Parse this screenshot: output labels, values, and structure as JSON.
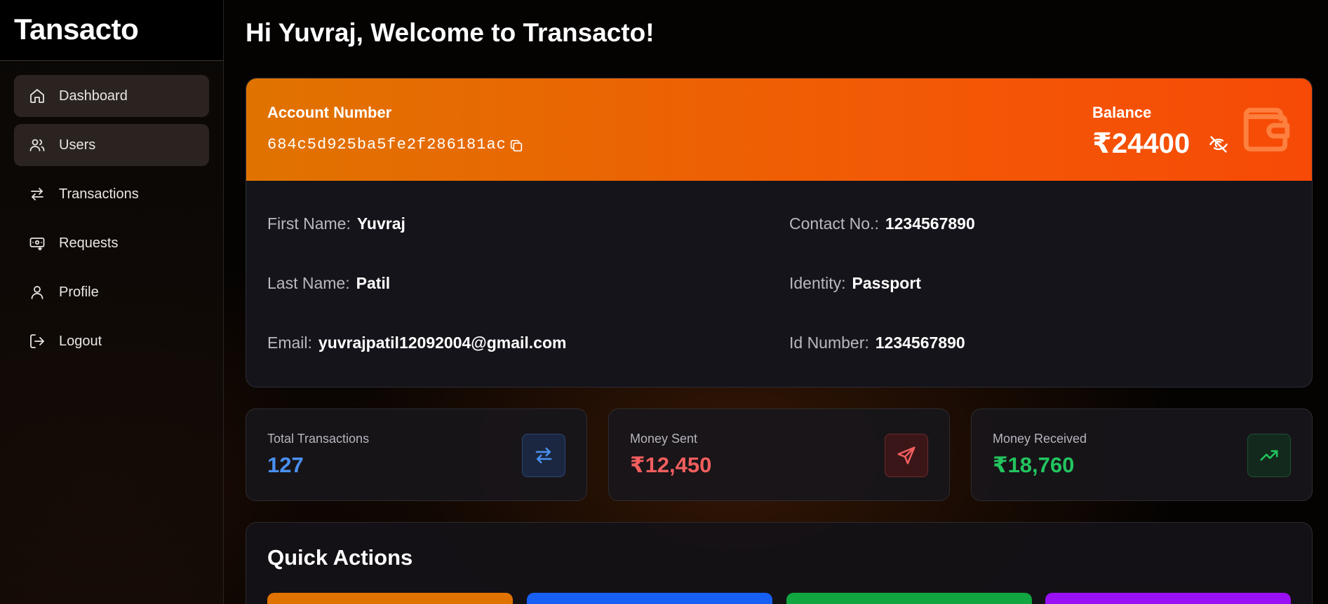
{
  "brand": "Tansacto",
  "nav": [
    {
      "label": "Dashboard",
      "icon": "home-icon"
    },
    {
      "label": "Users",
      "icon": "users-icon"
    },
    {
      "label": "Transactions",
      "icon": "transfer-icon"
    },
    {
      "label": "Requests",
      "icon": "money-request-icon"
    },
    {
      "label": "Profile",
      "icon": "user-icon"
    },
    {
      "label": "Logout",
      "icon": "logout-icon"
    }
  ],
  "welcome": "Hi Yuvraj, Welcome to Transacto!",
  "account": {
    "number_label": "Account Number",
    "number": "684c5d925ba5fe2f286181ac",
    "balance_label": "Balance",
    "balance": "₹24400"
  },
  "details": {
    "first_name": {
      "label": "First Name:",
      "value": "Yuvraj"
    },
    "last_name": {
      "label": "Last Name:",
      "value": "Patil"
    },
    "email": {
      "label": "Email:",
      "value": "yuvrajpatil12092004@gmail.com"
    },
    "contact": {
      "label": "Contact No.:",
      "value": "1234567890"
    },
    "identity": {
      "label": "Identity:",
      "value": "Passport"
    },
    "id_number": {
      "label": "Id Number:",
      "value": "1234567890"
    }
  },
  "stats": {
    "total": {
      "label": "Total Transactions",
      "value": "127",
      "color": "#4a90f0"
    },
    "sent": {
      "label": "Money Sent",
      "value": "₹12,450",
      "color": "#f25e5e"
    },
    "received": {
      "label": "Money Received",
      "value": "₹18,760",
      "color": "#22c55e"
    }
  },
  "quick_actions": {
    "title": "Quick Actions",
    "button_colors": [
      "#e07300",
      "#1760f5",
      "#12a640",
      "#9a10f5"
    ]
  },
  "colors": {
    "accent_start": "#e07300",
    "accent_end": "#f64a06"
  }
}
